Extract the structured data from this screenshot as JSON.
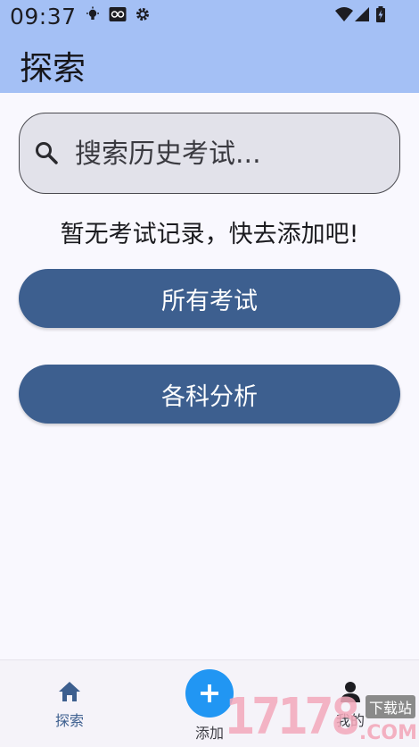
{
  "status_bar": {
    "time": "09:37"
  },
  "header": {
    "title": "探索"
  },
  "search": {
    "placeholder": "搜索历史考试..."
  },
  "empty_message": "暂无考试记录，快去添加吧!",
  "buttons": {
    "all_exams": "所有考试",
    "subject_analysis": "各科分析"
  },
  "bottom_nav": {
    "explore": "探索",
    "add": "添加",
    "mine": "我的"
  },
  "watermark": {
    "digits": "17178",
    "tag": "下载站",
    "suffix": ".COM"
  },
  "colors": {
    "header_bg": "#a4c0f5",
    "button_bg": "#3d5f8f",
    "fab_bg": "#2196f3",
    "active_nav": "#3d5f8f"
  }
}
